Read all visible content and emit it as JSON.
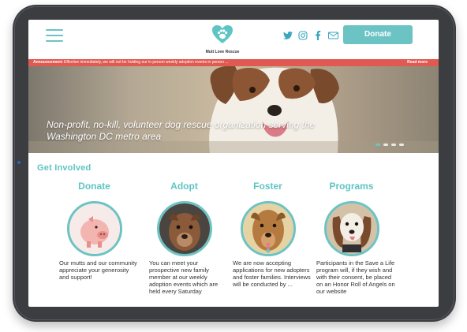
{
  "header": {
    "logo_text": "Mutt Love Rescue",
    "donate_label": "Donate",
    "social_icons": [
      "twitter-icon",
      "instagram-icon",
      "facebook-icon",
      "mail-icon"
    ]
  },
  "announcement": {
    "label": "Announcement:",
    "message": "Effective immediately, we will not be holding our in person weekly adoption events in person ...",
    "read_more": "Read more"
  },
  "hero": {
    "caption": "Non-profit, no-kill, volunteer dog rescue organization serving the Washington DC metro area",
    "slides": 4,
    "active_slide": 1
  },
  "section": {
    "heading": "Get Involved"
  },
  "cards": [
    {
      "title": "Donate",
      "description": "Our mutts and our community appreciate your generosity and support!"
    },
    {
      "title": "Adopt",
      "description": "You can meet your prospective new family member at our weekly adoption events which are held every Saturday"
    },
    {
      "title": "Foster",
      "description": "We are now accepting applications for new adopters and foster families. Interviews will be conducted by ..."
    },
    {
      "title": "Programs",
      "description": "Participants in the Save a Life program will, if they wish and with their consent, be placed on an Honor Roll of Angels on our website"
    }
  ],
  "colors": {
    "accent": "#6cc3c3",
    "announcement": "#e05a52"
  }
}
